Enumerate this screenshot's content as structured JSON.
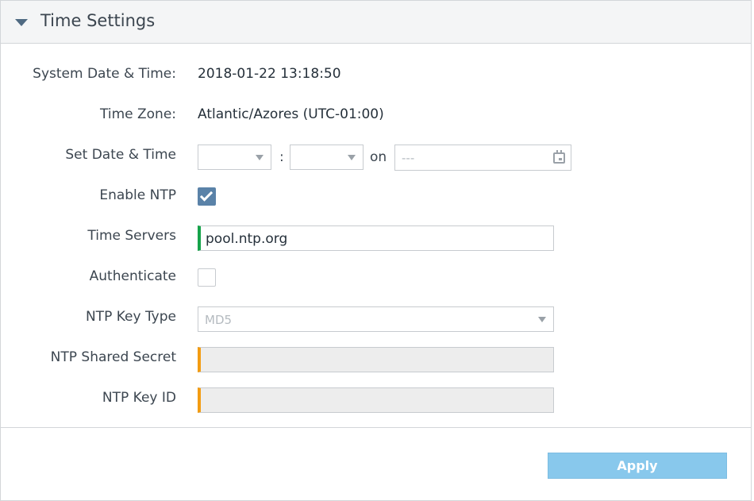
{
  "panel": {
    "title": "Time Settings"
  },
  "fields": {
    "system_date_time": {
      "label": "System Date & Time:",
      "value": "2018-01-22 13:18:50"
    },
    "time_zone": {
      "label": "Time Zone:",
      "value": "Atlantic/Azores (UTC-01:00)"
    },
    "set_date_time": {
      "label": "Set Date & Time",
      "hour_value": "",
      "minute_value": "",
      "separator": ":",
      "on_label": "on",
      "date_placeholder": "---"
    },
    "enable_ntp": {
      "label": "Enable NTP",
      "checked": true
    },
    "time_servers": {
      "label": "Time Servers",
      "value": "pool.ntp.org"
    },
    "authenticate": {
      "label": "Authenticate",
      "checked": false
    },
    "ntp_key_type": {
      "label": "NTP Key Type",
      "value": "MD5"
    },
    "ntp_shared_secret": {
      "label": "NTP Shared Secret",
      "value": ""
    },
    "ntp_key_id": {
      "label": "NTP Key ID",
      "value": ""
    }
  },
  "footer": {
    "apply_label": "Apply"
  },
  "colors": {
    "accent": "#5a82a8",
    "apply_button": "#88c8ec",
    "valid_indicator": "#16a34a",
    "required_indicator": "#f39c12"
  }
}
